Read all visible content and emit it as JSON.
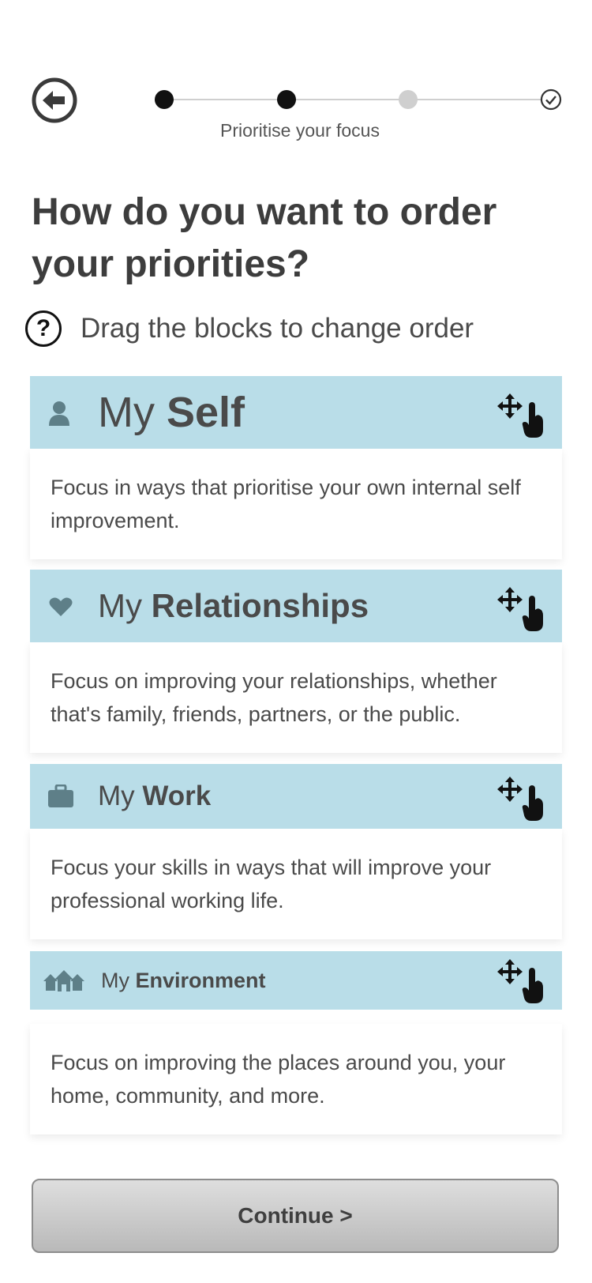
{
  "header": {
    "back_icon": "arrow-left-circle-icon",
    "progress": {
      "total_steps": 4,
      "current_step": 2,
      "final_icon": "check-circle-icon"
    },
    "step_label": "Prioritise your focus"
  },
  "main": {
    "headline": "How do you want to order your priorities?",
    "hint": {
      "icon": "question-circle-icon",
      "text": "Drag the blocks to change order"
    },
    "cards": [
      {
        "icon": "person-icon",
        "title_prefix": "My",
        "title_bold": "Self",
        "description": "Focus in ways that prioritise your own internal self improvement."
      },
      {
        "icon": "heart-icon",
        "title_prefix": "My",
        "title_bold": "Relationships",
        "description": "Focus on improving your relationships, whether that's family, friends, partners, or the public."
      },
      {
        "icon": "briefcase-icon",
        "title_prefix": "My",
        "title_bold": "Work",
        "description": "Focus your skills in ways that will improve your professional working life."
      },
      {
        "icon": "houses-icon",
        "title_prefix": "My",
        "title_bold": "Environment",
        "description": "Focus on improving the places around you, your home, community, and more."
      }
    ]
  },
  "footer": {
    "continue_label": "Continue >"
  },
  "colors": {
    "card_header": "#b9dde8",
    "icon": "#5e7f88",
    "text": "#4a4a4a",
    "progress_done": "#111111",
    "progress_todo": "#cfcfcf"
  }
}
